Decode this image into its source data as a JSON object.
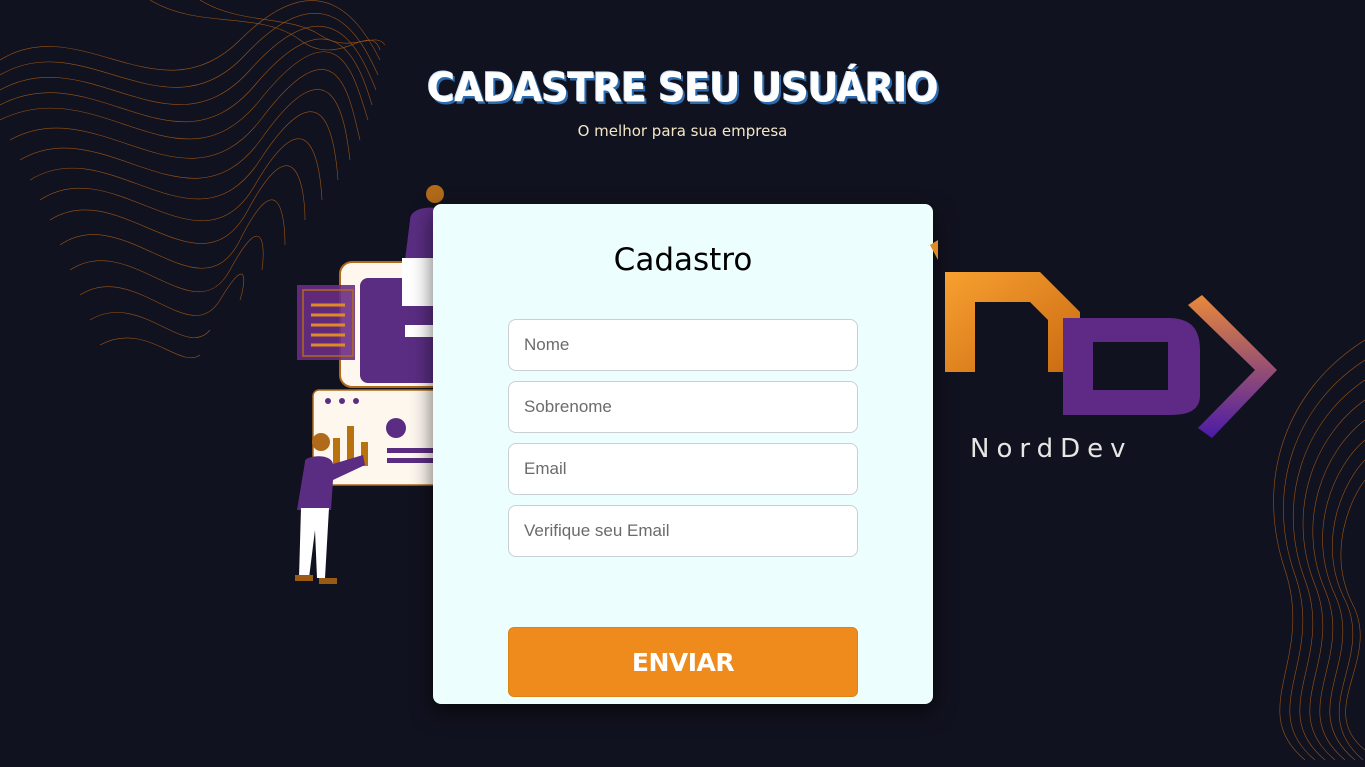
{
  "header": {
    "title": "CADASTRE SEU USUÁRIO",
    "subtitle": "O melhor para sua empresa"
  },
  "form": {
    "title": "Cadastro",
    "fields": [
      {
        "placeholder": "Nome",
        "value": ""
      },
      {
        "placeholder": "Sobrenome",
        "value": ""
      },
      {
        "placeholder": "Email",
        "value": ""
      },
      {
        "placeholder": "Verifique seu Email",
        "value": ""
      }
    ],
    "submit_label": "ENVIAR"
  },
  "brand": {
    "name": "NordDev",
    "icon": "norddev-logo"
  },
  "colors": {
    "background": "#11121f",
    "accent_orange": "#ee8b1c",
    "accent_purple": "#6a2c84",
    "card": "#ecfefe"
  }
}
